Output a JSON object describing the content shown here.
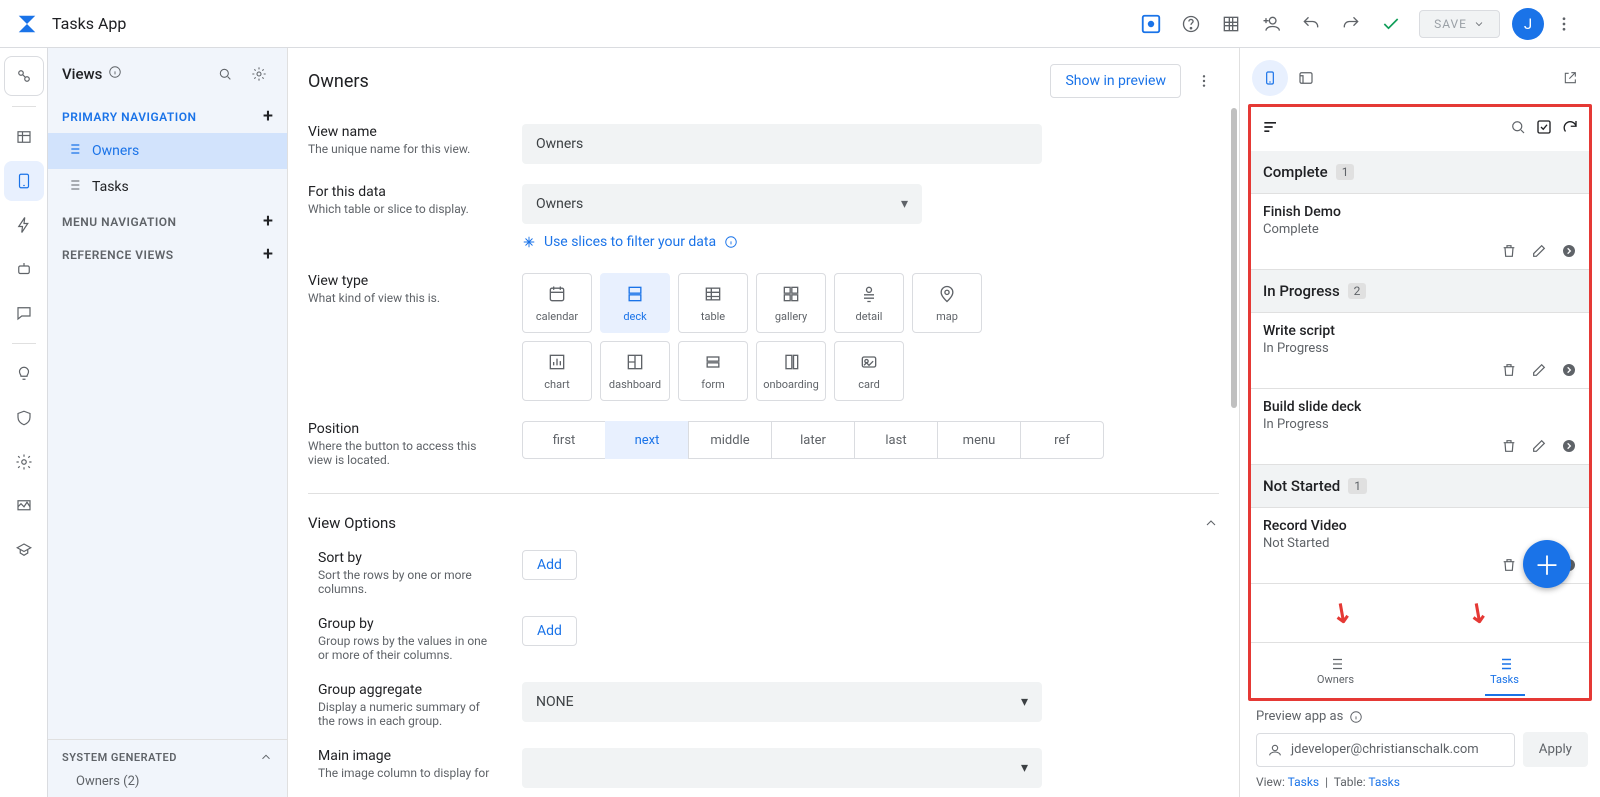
{
  "topbar": {
    "app_title": "Tasks App",
    "save_label": "SAVE",
    "avatar_initial": "J"
  },
  "views_sidebar": {
    "header": "Views",
    "sections": {
      "primary": "PRIMARY NAVIGATION",
      "menu": "MENU NAVIGATION",
      "reference": "REFERENCE VIEWS",
      "system": "SYSTEM GENERATED"
    },
    "items": {
      "owners": "Owners",
      "tasks": "Tasks"
    },
    "system_sub": "Owners (2)"
  },
  "main": {
    "title": "Owners",
    "show_in_preview": "Show in preview",
    "view_name": {
      "label": "View name",
      "help": "The unique name for this view.",
      "value": "Owners"
    },
    "for_data": {
      "label": "For this data",
      "help": "Which table or slice to display.",
      "value": "Owners",
      "slice_link": "Use slices to filter your data"
    },
    "view_type": {
      "label": "View type",
      "help": "What kind of view this is.",
      "options": [
        "calendar",
        "deck",
        "table",
        "gallery",
        "detail",
        "map",
        "chart",
        "dashboard",
        "form",
        "onboarding",
        "card"
      ],
      "selected": "deck"
    },
    "position": {
      "label": "Position",
      "help": "Where the button to access this view is located.",
      "options": [
        "first",
        "next",
        "middle",
        "later",
        "last",
        "menu",
        "ref"
      ],
      "selected": "next"
    },
    "view_options_header": "View Options",
    "sort_by": {
      "label": "Sort by",
      "help": "Sort the rows by one or more columns.",
      "add": "Add"
    },
    "group_by": {
      "label": "Group by",
      "help": "Group rows by the values in one or more of their columns.",
      "add": "Add"
    },
    "group_agg": {
      "label": "Group aggregate",
      "help": "Display a numeric summary of the rows in each group.",
      "value": "NONE"
    },
    "main_img": {
      "label": "Main image",
      "help": "The image column to display for"
    }
  },
  "preview": {
    "groups": [
      {
        "title": "Complete",
        "count": "1",
        "items": [
          {
            "title": "Finish Demo",
            "sub": "Complete"
          }
        ]
      },
      {
        "title": "In Progress",
        "count": "2",
        "items": [
          {
            "title": "Write script",
            "sub": "In Progress"
          },
          {
            "title": "Build slide deck",
            "sub": "In Progress"
          }
        ]
      },
      {
        "title": "Not Started",
        "count": "1",
        "items": [
          {
            "title": "Record Video",
            "sub": "Not Started"
          }
        ]
      }
    ],
    "bottom_tabs": {
      "owners": "Owners",
      "tasks": "Tasks"
    },
    "footer": {
      "preview_as": "Preview app as",
      "email": "jdeveloper@christianschalk.com",
      "apply": "Apply",
      "view_label": "View:",
      "view_value": "Tasks",
      "table_label": "Table:",
      "table_value": "Tasks"
    }
  }
}
